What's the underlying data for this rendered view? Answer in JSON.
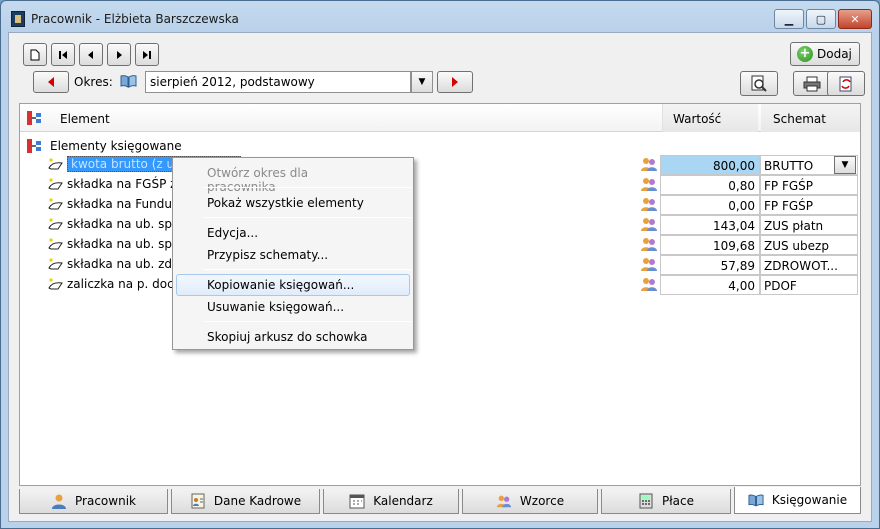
{
  "window": {
    "title": "Pracownik - Elżbieta Barszczewska"
  },
  "toolbar": {
    "add_label": "Dodaj"
  },
  "period": {
    "label": "Okres:",
    "value": "sierpień 2012, podstawowy"
  },
  "grid": {
    "headers": {
      "element": "Element",
      "value": "Wartość",
      "schema": "Schemat"
    },
    "group_label": "Elementy księgowane",
    "rows": [
      {
        "label": "kwota brutto (z uwz",
        "value": "800,00",
        "schema": "BRUTTO"
      },
      {
        "label": "składka na FGŚP za p",
        "value": "0,80",
        "schema": "FP FGŚP"
      },
      {
        "label": "składka na Fundusz",
        "value": "0,00",
        "schema": "FP FGŚP"
      },
      {
        "label": "składka na ub. społ.",
        "value": "143,04",
        "schema": "ZUS płatn"
      },
      {
        "label": "składka na ub. społ.",
        "value": "109,68",
        "schema": "ZUS ubezp"
      },
      {
        "label": "składka na ub. zdrow",
        "value": "57,89",
        "schema": "ZDROWOT..."
      },
      {
        "label": "zaliczka na p. doch.",
        "value": "4,00",
        "schema": "PDOF"
      }
    ]
  },
  "context_menu": {
    "items": [
      "Otwórz okres dla pracownika",
      "Pokaż wszystkie elementy",
      "Edycja...",
      "Przypisz schematy...",
      "Kopiowanie księgowań...",
      "Usuwanie księgowań...",
      "Skopiuj arkusz do schowka"
    ]
  },
  "tabs": [
    "Pracownik",
    "Dane Kadrowe",
    "Kalendarz",
    "Wzorce",
    "Płace",
    "Księgowanie"
  ],
  "colors": {
    "accent_red": "#d40000",
    "selection": "#3399ff",
    "value_highlight": "#a9d6f2"
  }
}
